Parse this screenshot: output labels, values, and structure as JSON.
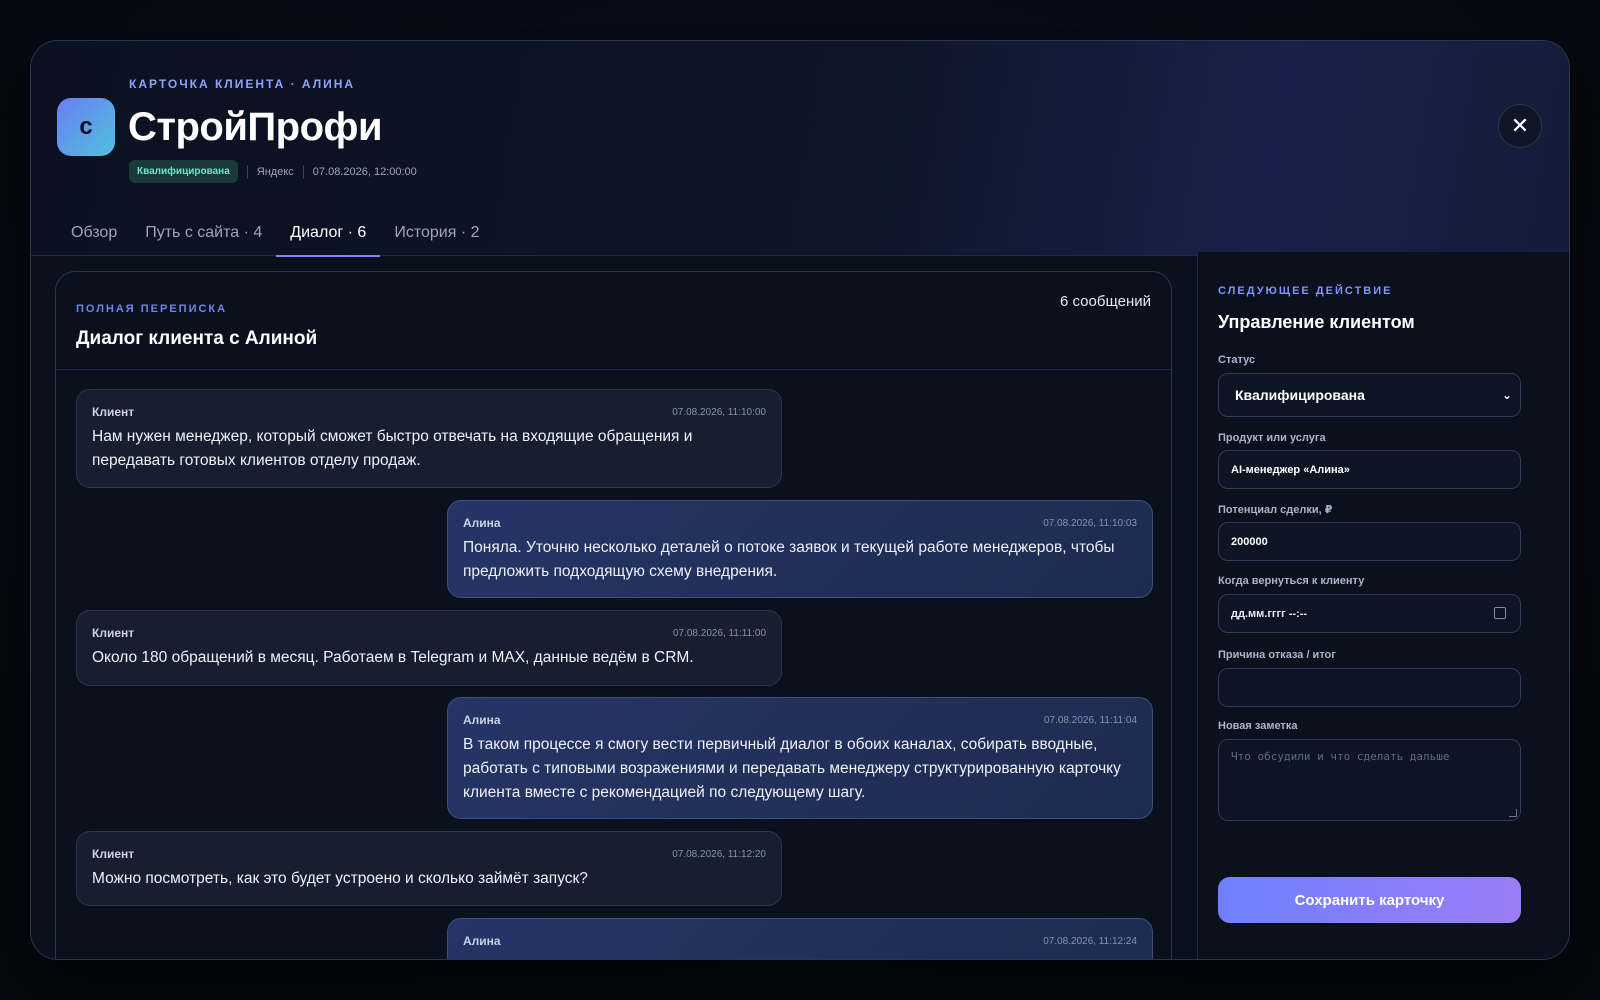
{
  "header": {
    "avatar_letter": "с",
    "eyebrow": "КАРТОЧКА КЛИЕНТА · АЛИНА",
    "title": "СтройПрофи",
    "status_badge": "Квалифицирована",
    "source": "Яндекс",
    "created_at": "07.08.2026, 12:00:00",
    "close_symbol": "✕"
  },
  "tabs": [
    {
      "label": "Обзор",
      "active": false
    },
    {
      "label": "Путь с сайта · 4",
      "active": false
    },
    {
      "label": "Диалог · 6",
      "active": true
    },
    {
      "label": "История · 2",
      "active": false
    }
  ],
  "dialog": {
    "eyebrow": "ПОЛНАЯ ПЕРЕПИСКА",
    "title": "Диалог клиента с Алиной",
    "count": "6 сообщений",
    "messages": [
      {
        "author": "Клиент",
        "time": "07.08.2026, 11:10:00",
        "text": "Нам нужен менеджер, который сможет быстро отвечать на входящие обращения и передавать готовых клиентов отделу продаж."
      },
      {
        "author": "Алина",
        "time": "07.08.2026, 11:10:03",
        "text": "Поняла. Уточню несколько деталей о потоке заявок и текущей работе менеджеров, чтобы предложить подходящую схему внедрения."
      },
      {
        "author": "Клиент",
        "time": "07.08.2026, 11:11:00",
        "text": "Около 180 обращений в месяц. Работаем в Telegram и MAX, данные ведём в CRM."
      },
      {
        "author": "Алина",
        "time": "07.08.2026, 11:11:04",
        "text": "В таком процессе я смогу вести первичный диалог в обоих каналах, собирать вводные, работать с типовыми возражениями и передавать менеджеру структурированную карточку клиента вместе с рекомендацией по следующему шагу."
      },
      {
        "author": "Клиент",
        "time": "07.08.2026, 11:12:20",
        "text": "Можно посмотреть, как это будет устроено и сколько займёт запуск?"
      },
      {
        "author": "Алина",
        "time": "07.08.2026, 11:12:24",
        "text": ""
      }
    ]
  },
  "side": {
    "eyebrow": "СЛЕДУЮЩЕЕ ДЕЙСТВИЕ",
    "title": "Управление клиентом",
    "status_label": "Статус",
    "status_value": "Квалифицирована",
    "product_label": "Продукт или услуга",
    "product_value": "AI-менеджер «Алина»",
    "potential_label": "Потенциал сделки, ₽",
    "potential_value": "200000",
    "followup_label": "Когда вернуться к клиенту",
    "followup_placeholder": "дд.мм.гггг  --:--",
    "reason_label": "Причина отказа / итог",
    "reason_value": "",
    "note_label": "Новая заметка",
    "note_placeholder": "Что обсудили и что сделать дальше",
    "save_label": "Сохранить карточку"
  }
}
